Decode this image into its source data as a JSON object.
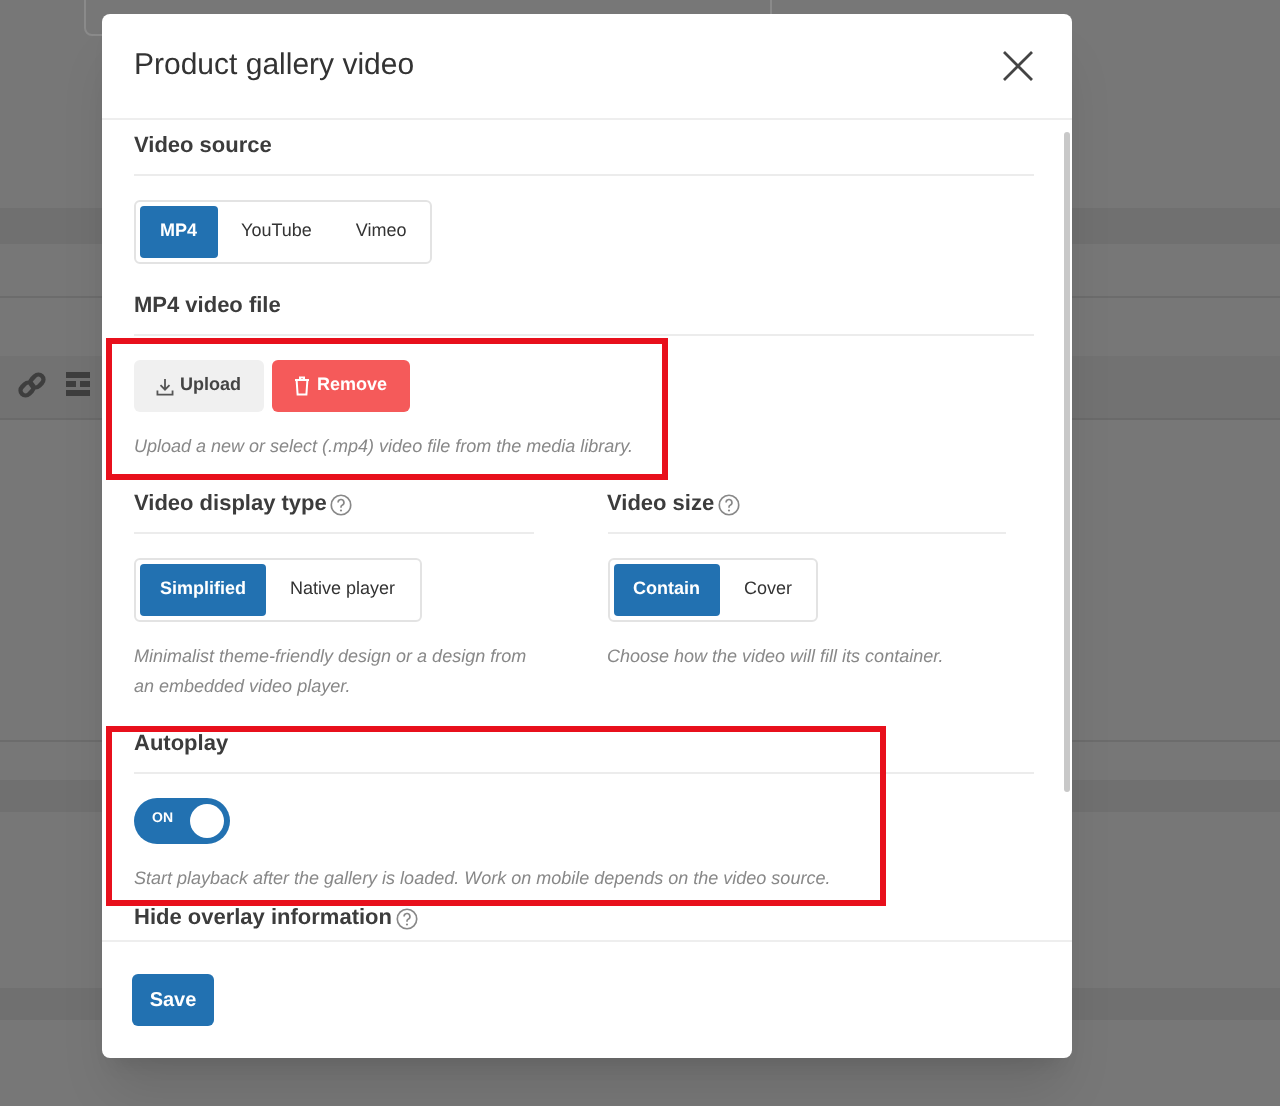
{
  "dialog": {
    "title": "Product gallery video",
    "sections": [
      {
        "kind": "segmented",
        "label": "Video source",
        "help_icon": false,
        "options": [
          {
            "label": "MP4",
            "selected": true
          },
          {
            "label": "YouTube",
            "selected": false
          },
          {
            "label": "Vimeo",
            "selected": false
          }
        ]
      },
      {
        "kind": "file",
        "label": "MP4 video file",
        "highlighted": true,
        "buttons": [
          {
            "label": "Upload",
            "kind": "upload"
          },
          {
            "label": "Remove",
            "kind": "remove"
          }
        ],
        "help": "Upload a new or select (.mp4) video file from the media library."
      },
      {
        "kind": "columns",
        "columns": [
          {
            "kind": "segmented",
            "label": "Video display type",
            "help_icon": true,
            "options": [
              {
                "label": "Simplified",
                "selected": true
              },
              {
                "label": "Native player",
                "selected": false
              }
            ],
            "help": "Minimalist theme-friendly design or a design from an embedded video player."
          },
          {
            "kind": "segmented",
            "label": "Video size",
            "help_icon": true,
            "options": [
              {
                "label": "Contain",
                "selected": true
              },
              {
                "label": "Cover",
                "selected": false
              }
            ],
            "help": "Choose how the video will fill its container."
          }
        ]
      },
      {
        "kind": "toggle",
        "label": "Autoplay",
        "highlighted": true,
        "on": true,
        "toggle_label": "ON",
        "help": "Start playback after the gallery is loaded. Work on mobile depends on the video source."
      },
      {
        "kind": "heading",
        "label": "Hide overlay information",
        "help_icon": true
      }
    ],
    "footer": {
      "button": "Save"
    }
  }
}
